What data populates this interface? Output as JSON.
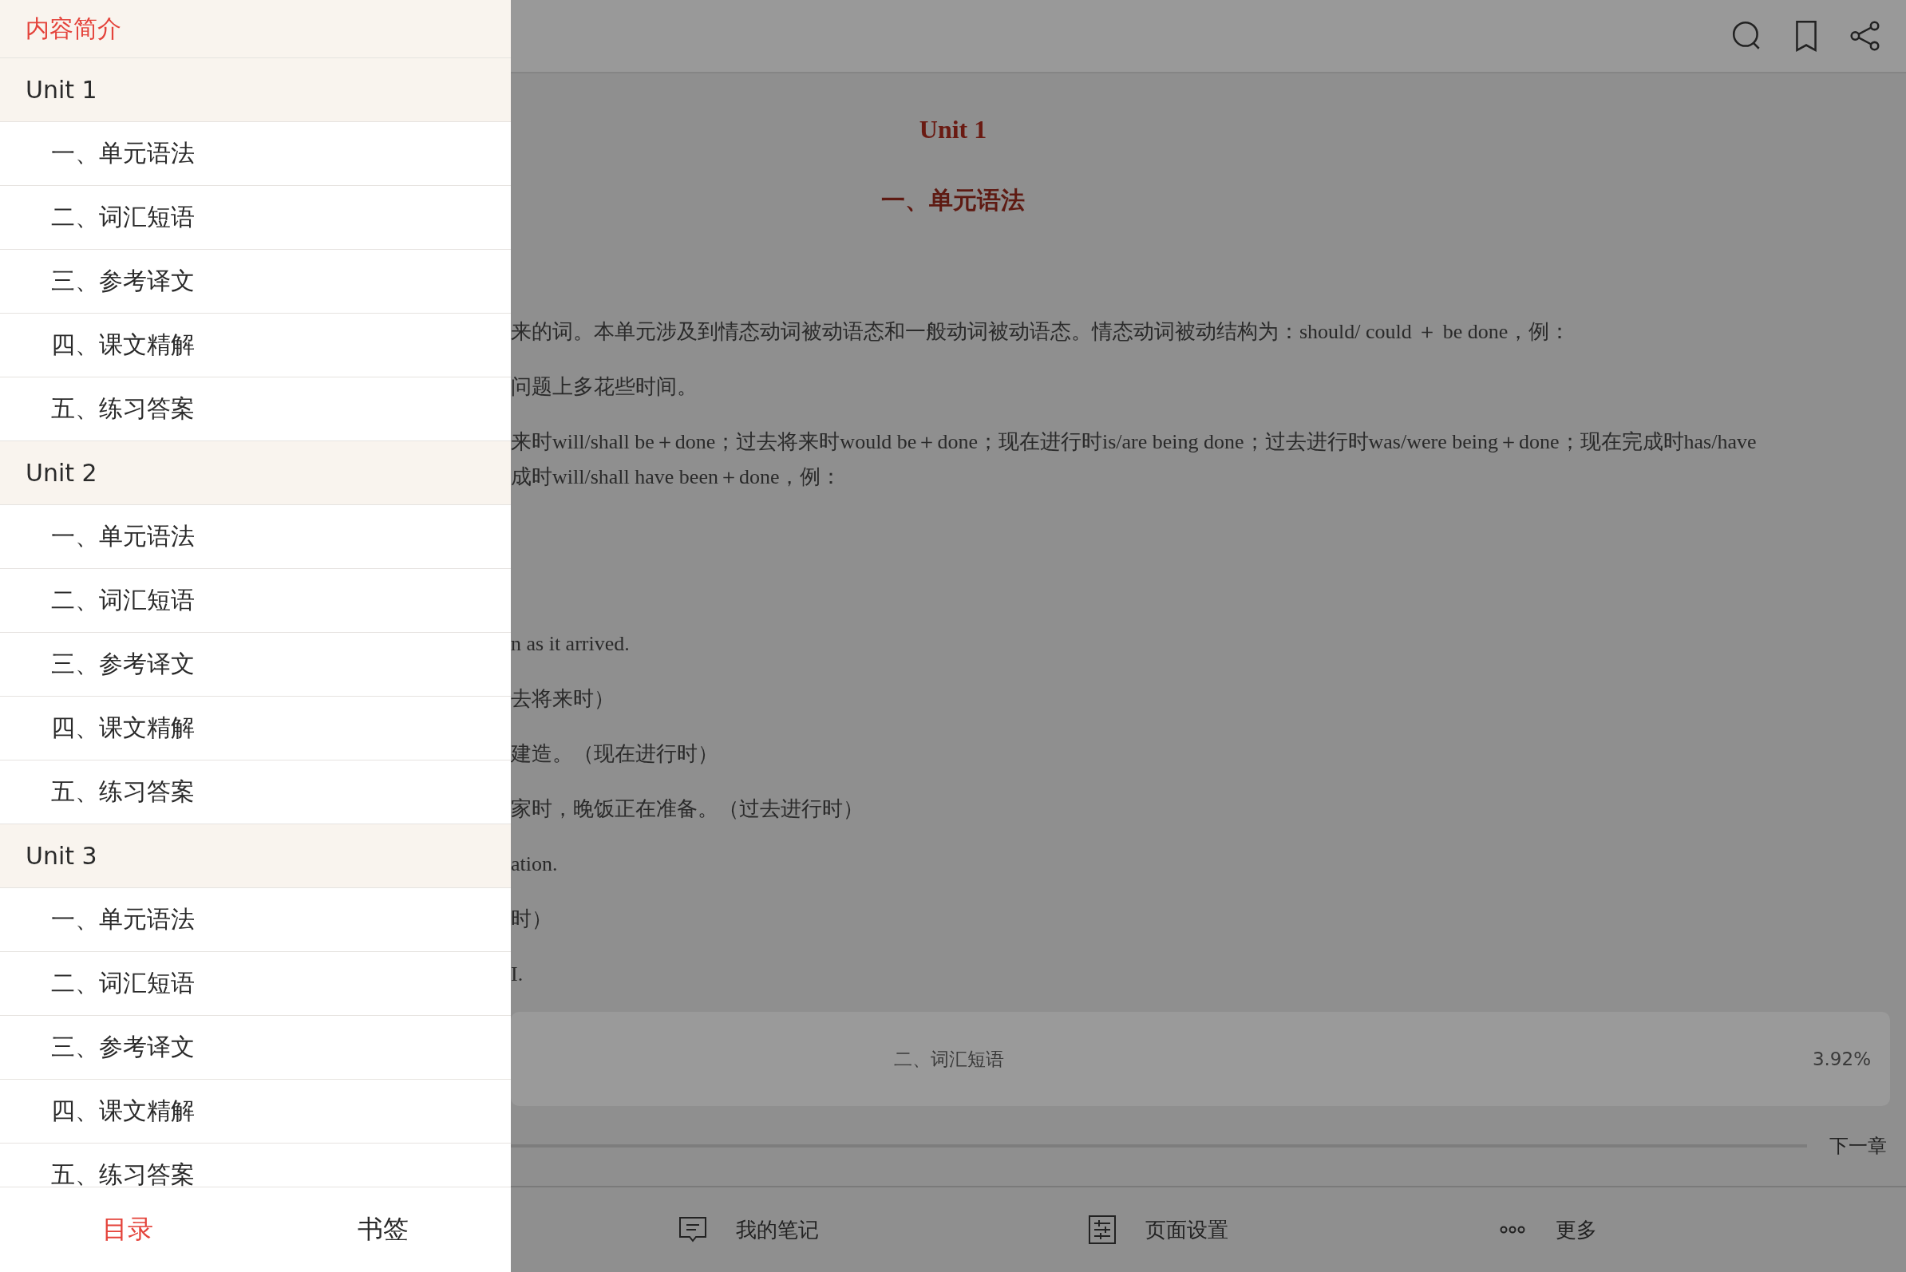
{
  "toc": [
    {
      "label": "内容简介",
      "selected": true
    },
    {
      "label": "Unit 1",
      "selected": false,
      "children": [
        {
          "label": "一、单元语法",
          "selected": false
        },
        {
          "label": "二、词汇短语",
          "selected": false
        },
        {
          "label": "三、参考译文",
          "selected": false
        },
        {
          "label": "四、课文精解",
          "selected": false
        },
        {
          "label": "五、练习答案",
          "selected": false
        }
      ]
    },
    {
      "label": "Unit 2",
      "selected": false,
      "children": [
        {
          "label": "一、单元语法",
          "selected": false
        },
        {
          "label": "二、词汇短语",
          "selected": false
        },
        {
          "label": "三、参考译文",
          "selected": false
        },
        {
          "label": "四、课文精解",
          "selected": false
        },
        {
          "label": "五、练习答案",
          "selected": false
        }
      ]
    },
    {
      "label": "Unit 3",
      "selected": false,
      "children": [
        {
          "label": "一、单元语法",
          "selected": false
        },
        {
          "label": "二、词汇短语",
          "selected": false
        },
        {
          "label": "三、参考译文",
          "selected": false
        },
        {
          "label": "四、课文精解",
          "selected": false
        },
        {
          "label": "五、练习答案",
          "selected": false
        }
      ]
    }
  ],
  "sidebar_tabs": [
    {
      "label": "目录",
      "selected": true
    },
    {
      "label": "书签",
      "selected": false
    }
  ],
  "reader": {
    "title": "Unit 1",
    "heading": "一、单元语法",
    "paragraphs": [
      {
        "lines": [
          "来的词。本单元涉及到情态动词被动语态和一般动词被动语态。情态动词被动结构为：should/ could ＋ be done，例："
        ]
      },
      {
        "lines": [
          "问题上多花些时间。"
        ]
      },
      {
        "lines": [
          "来时will/shall be＋done；过去将来时would be＋done；现在进行时is/are being done；过去进行时was/were being＋done；现在完成时has/have",
          "成时will/shall have been＋done，例："
        ]
      },
      {
        "lines": [
          "n as it arrived."
        ]
      },
      {
        "lines": [
          "去将来时）"
        ]
      },
      {
        "lines": [
          "建造。（现在进行时）"
        ]
      },
      {
        "lines": [
          "家时，晚饭正在准备。（过去进行时）"
        ]
      },
      {
        "lines": [
          "ation."
        ]
      },
      {
        "lines": [
          "时）"
        ]
      },
      {
        "lines": [
          "I."
        ]
      }
    ]
  },
  "progress_card": {
    "chapter": "二、词汇短语",
    "percent": "3.92%"
  },
  "next_chapter": "下一章",
  "toolbar": [
    {
      "kind": "notes",
      "label": "我的笔记"
    },
    {
      "kind": "settings",
      "label": "页面设置"
    },
    {
      "kind": "more",
      "label": "更多"
    }
  ]
}
